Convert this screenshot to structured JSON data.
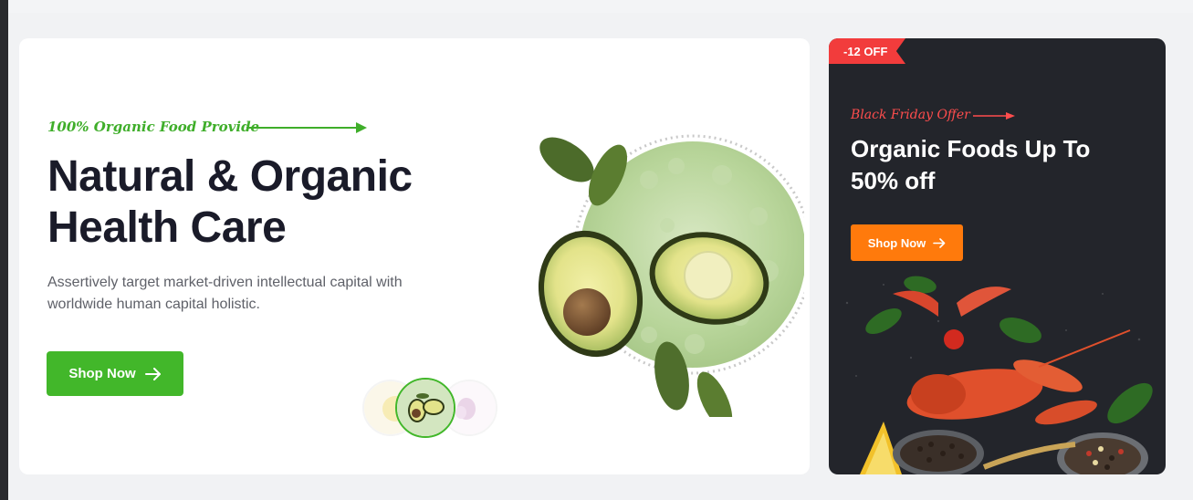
{
  "hero": {
    "tagline": "100% Organic Food Provide",
    "headline": "Natural & Organic Health Care",
    "description": "Assertively target market-driven intellectual capital with worldwide human capital holistic.",
    "cta_label": "Shop Now",
    "slides": [
      {
        "name": "lemon-slide-thumbnail",
        "active": false
      },
      {
        "name": "avocado-slide-thumbnail",
        "active": true
      },
      {
        "name": "onion-slide-thumbnail",
        "active": false
      }
    ]
  },
  "promo": {
    "badge": "-12 OFF",
    "eyebrow": "Black Friday Offer",
    "title": "Organic Foods Up To 50% off",
    "cta_label": "Shop Now"
  },
  "colors": {
    "brand_green": "#42b72a",
    "heading": "#1a1b29",
    "promo_bg": "#23252b",
    "badge_red": "#f23c3c",
    "accent_orange": "#ff7a0c"
  }
}
